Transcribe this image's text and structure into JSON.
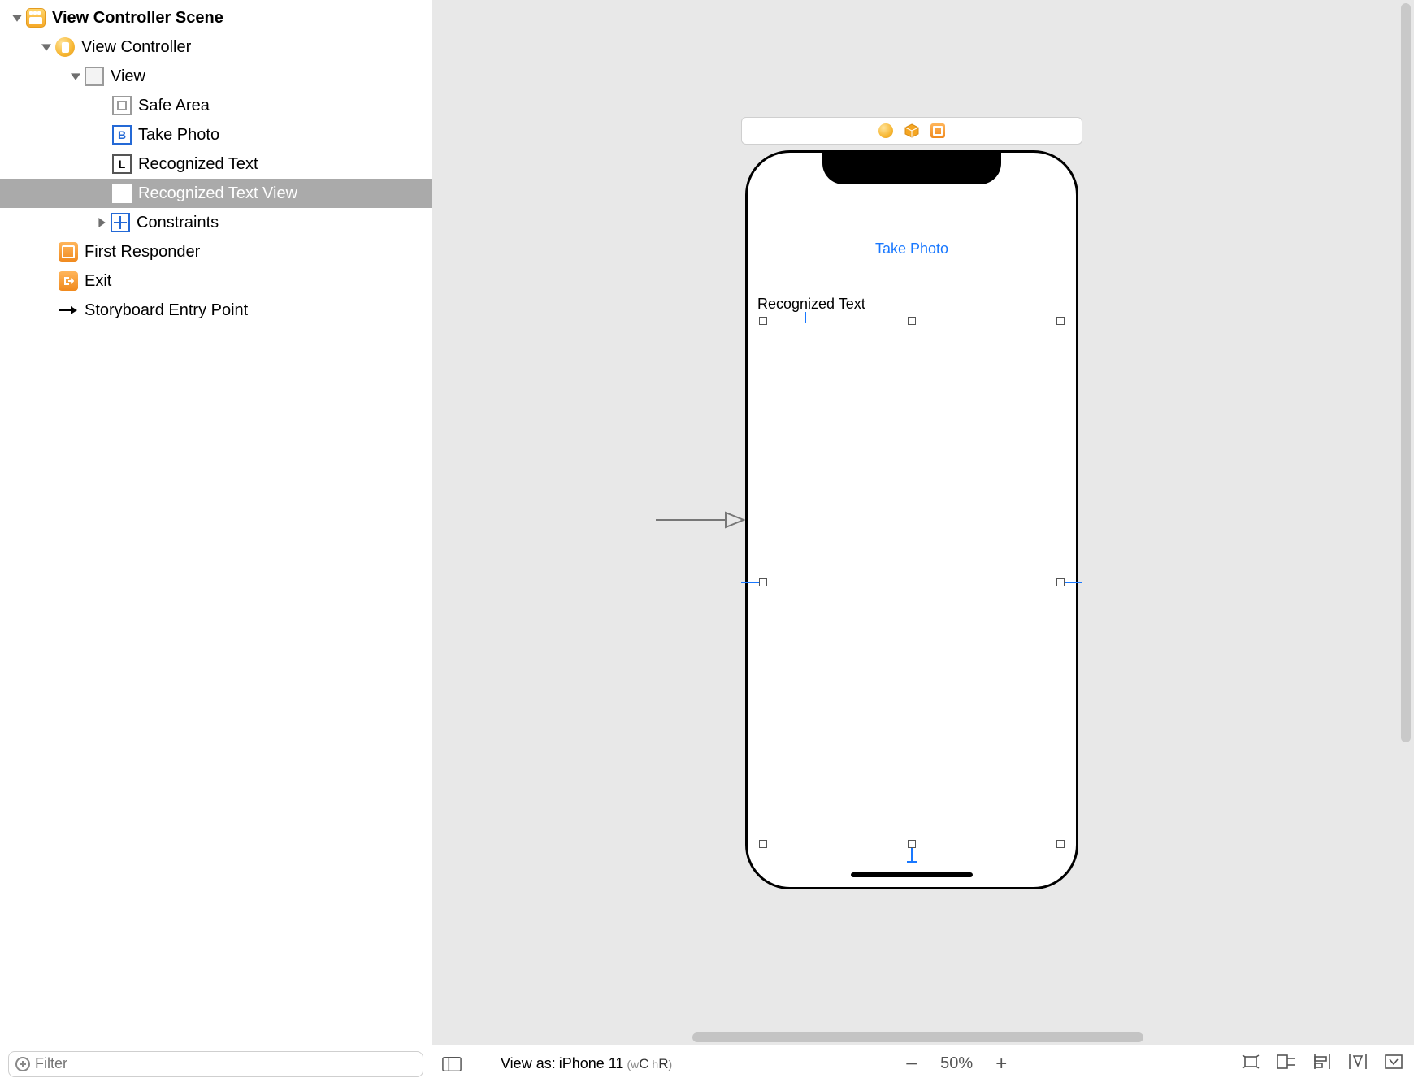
{
  "outline": {
    "scene": "View Controller Scene",
    "vc": "View Controller",
    "view": "View",
    "safe": "Safe Area",
    "takePhoto": "Take Photo",
    "recText": "Recognized Text",
    "recTextView": "Recognized Text View",
    "constraints": "Constraints",
    "firstResponder": "First Responder",
    "exit": "Exit",
    "entry": "Storyboard Entry Point"
  },
  "filter": {
    "placeholder": "Filter"
  },
  "canvas": {
    "buttonTitle": "Take Photo",
    "labelText": "Recognized Text"
  },
  "bottomBar": {
    "viewAsPrefix": "View as: ",
    "deviceName": "iPhone 11",
    "sizeClassW": "w",
    "sizeClassC": "C",
    "sizeClassH": "h",
    "sizeClassR": "R",
    "zoom": "50%"
  }
}
